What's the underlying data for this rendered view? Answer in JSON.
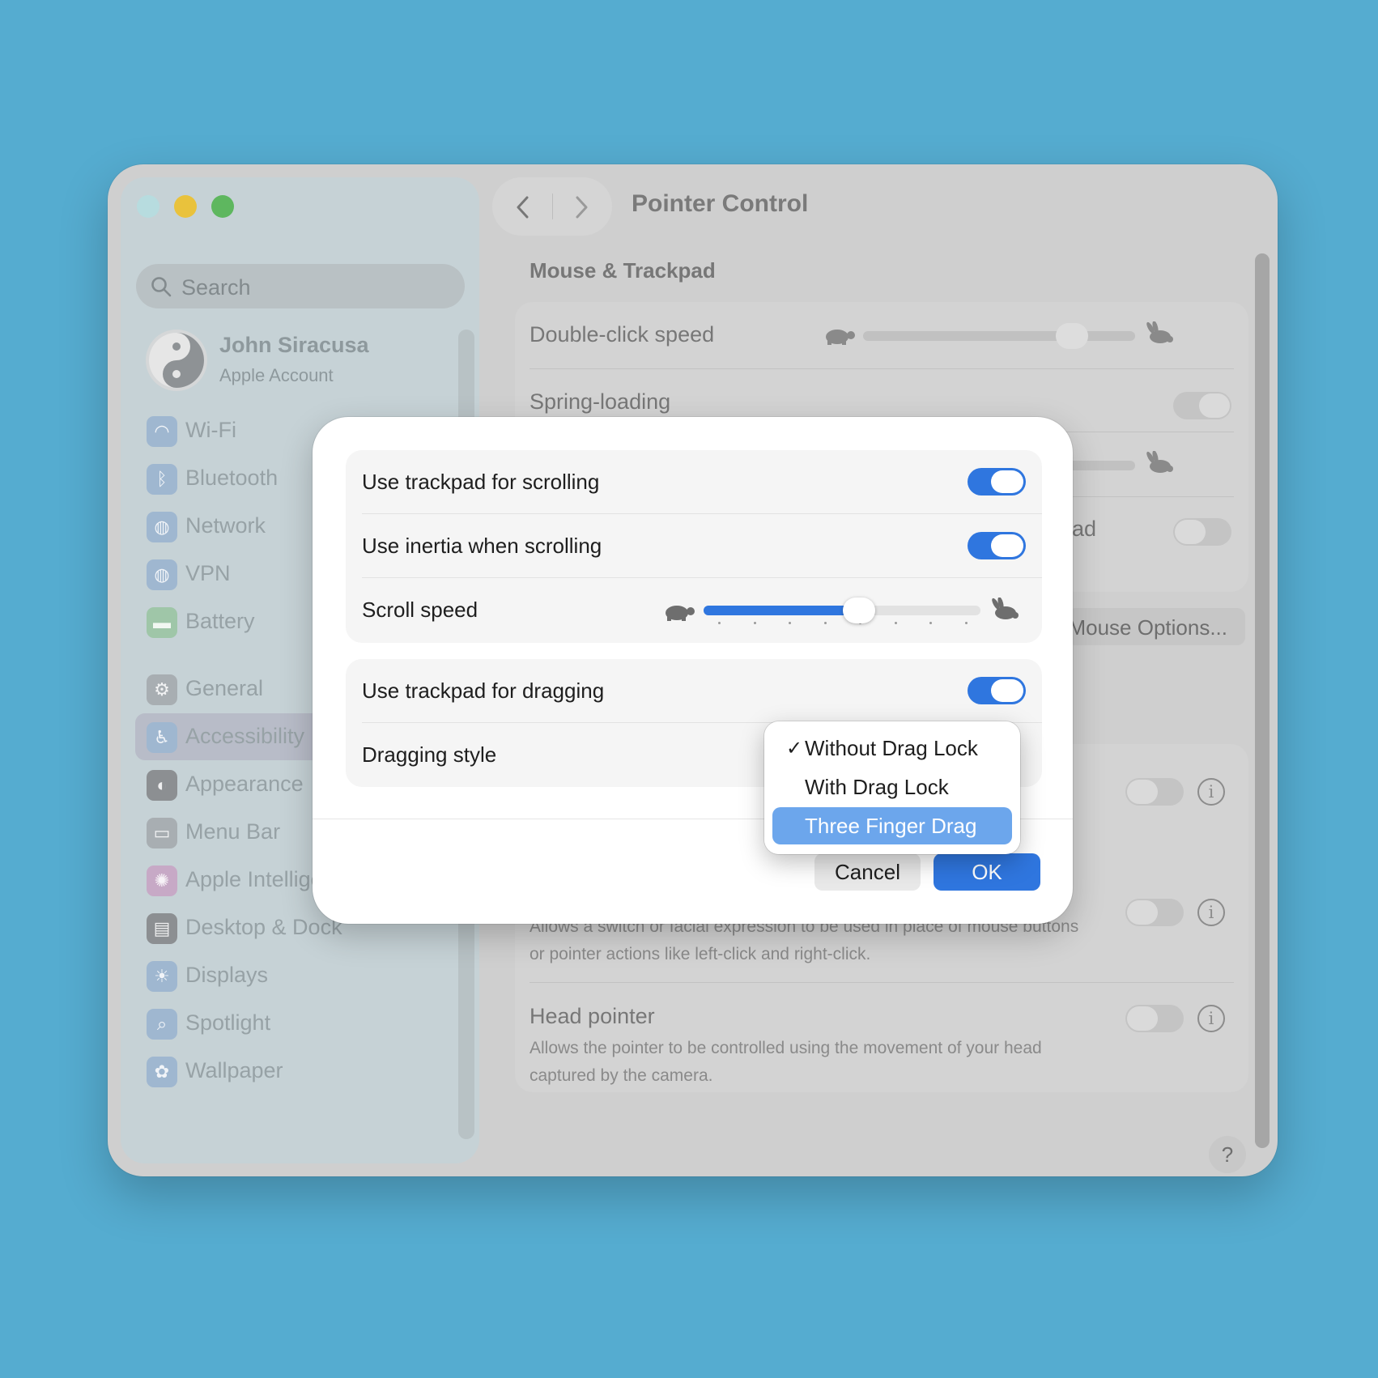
{
  "window": {
    "title": "Pointer Control"
  },
  "sidebar": {
    "search_placeholder": "Search",
    "account": {
      "name": "John Siracusa",
      "subtitle": "Apple Account"
    },
    "items": [
      {
        "label": "Wi-Fi",
        "icon": "wifi-icon",
        "color": "#9FB7D0"
      },
      {
        "label": "Bluetooth",
        "icon": "bluetooth-icon",
        "color": "#9FB7D0"
      },
      {
        "label": "Network",
        "icon": "globe-icon",
        "color": "#9FB7D0"
      },
      {
        "label": "VPN",
        "icon": "vpn-globe-icon",
        "color": "#9FB7D0"
      },
      {
        "label": "Battery",
        "icon": "battery-icon",
        "color": "#9FC6A8"
      },
      {
        "label": "General",
        "icon": "gear-icon",
        "color": "#A8AEB2"
      },
      {
        "label": "Accessibility",
        "icon": "accessibility-icon",
        "color": "#9FB7D0",
        "selected": true
      },
      {
        "label": "Appearance",
        "icon": "appearance-icon",
        "color": "#8C8F92"
      },
      {
        "label": "Menu Bar",
        "icon": "menubar-icon",
        "color": "#A8AEB2"
      },
      {
        "label": "Apple Intelligence & Siri",
        "icon": "siri-icon",
        "color": "#C7A9C6"
      },
      {
        "label": "Desktop & Dock",
        "icon": "dock-icon",
        "color": "#8C8F92"
      },
      {
        "label": "Displays",
        "icon": "sun-icon",
        "color": "#9FB7D0"
      },
      {
        "label": "Spotlight",
        "icon": "spotlight-icon",
        "color": "#9FB7D0"
      },
      {
        "label": "Wallpaper",
        "icon": "flower-icon",
        "color": "#9FB7D0"
      }
    ]
  },
  "main": {
    "section_title": "Mouse & Trackpad",
    "double_click_label": "Double-click speed",
    "spring_loading_label": "Spring-loading",
    "partial_label": "ad",
    "mouse_options_button": "Mouse Options...",
    "alt_pointer_desc": "Allows a switch or facial expression to be used in place of mouse buttons or pointer actions like left-click and right-click.",
    "head_pointer_label": "Head pointer",
    "head_pointer_desc": "Allows the pointer to be controlled using the movement of your head captured by the camera.",
    "help_label": "?"
  },
  "dialog": {
    "scroll_toggle_label": "Use trackpad for scrolling",
    "inertia_toggle_label": "Use inertia when scrolling",
    "scroll_speed_label": "Scroll speed",
    "scroll_speed_value": 0.56,
    "drag_toggle_label": "Use trackpad for dragging",
    "dragging_style_label": "Dragging style",
    "cancel_label": "Cancel",
    "ok_label": "OK",
    "accent_color": "#2F76DF"
  },
  "dropdown": {
    "options": [
      {
        "label": "Without Drag Lock",
        "checked": true
      },
      {
        "label": "With Drag Lock"
      },
      {
        "label": "Three Finger Drag",
        "highlighted": true
      }
    ],
    "checkmark": "✓"
  }
}
